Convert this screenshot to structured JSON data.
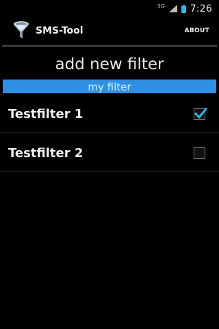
{
  "status_bar": {
    "network": "3G",
    "time": "7:26"
  },
  "action_bar": {
    "app_icon": "funnel-filter-icon",
    "title": "SMS-Tool",
    "about_label": "ABOUT"
  },
  "main": {
    "add_filter_label": "add new filter",
    "section_header": "my filter",
    "filters": [
      {
        "label": "Testfilter 1",
        "checked": true
      },
      {
        "label": "Testfilter 2",
        "checked": false
      }
    ]
  },
  "colors": {
    "accent": "#2f8fe3",
    "checkmark": "#33b5e5",
    "background": "#000000"
  }
}
